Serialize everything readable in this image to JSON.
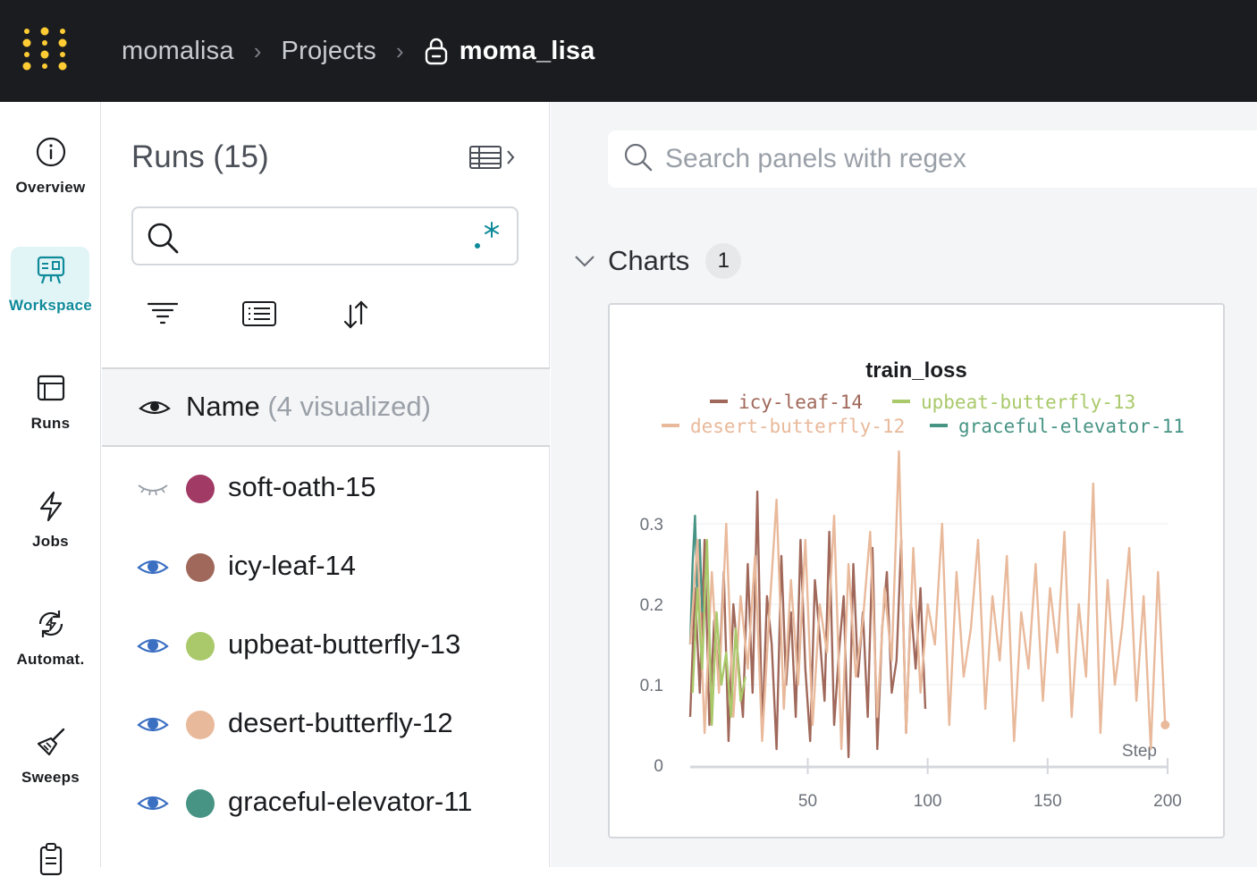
{
  "breadcrumb": {
    "entity": "momalisa",
    "section": "Projects",
    "project": "moma_lisa"
  },
  "nav": [
    {
      "label": "Overview",
      "icon": "info-icon"
    },
    {
      "label": "Workspace",
      "icon": "workspace-icon",
      "active": true
    },
    {
      "label": "Runs",
      "icon": "runs-table-icon"
    },
    {
      "label": "Jobs",
      "icon": "lightning-icon"
    },
    {
      "label": "Automat.",
      "icon": "automation-icon"
    },
    {
      "label": "Sweeps",
      "icon": "broom-icon"
    }
  ],
  "runs_panel": {
    "title": "Runs (15)",
    "search_value": "",
    "header_name": "Name",
    "header_sub": "(4 visualized)",
    "runs": [
      {
        "name": "soft-oath-15",
        "color": "#a23a66",
        "visible": false
      },
      {
        "name": "icy-leaf-14",
        "color": "#a0685a",
        "visible": true
      },
      {
        "name": "upbeat-butterfly-13",
        "color": "#a9c96a",
        "visible": true
      },
      {
        "name": "desert-butterfly-12",
        "color": "#e9b99b",
        "visible": true
      },
      {
        "name": "graceful-elevator-11",
        "color": "#479485",
        "visible": true
      }
    ]
  },
  "main": {
    "search_placeholder": "Search panels with regex",
    "section_title": "Charts",
    "section_count": "1"
  },
  "chart_data": {
    "type": "line",
    "title": "train_loss",
    "xlabel": "Step",
    "ylabel": "",
    "xlim": [
      1,
      200
    ],
    "ylim": [
      0,
      0.35
    ],
    "xticks": [
      50,
      100,
      150,
      200
    ],
    "yticks": [
      0,
      0.1,
      0.2,
      0.3
    ],
    "ytick_labels": [
      "0",
      "0.1",
      "0.2",
      "0.3"
    ],
    "grid": true,
    "legend": "top",
    "series": [
      {
        "name": "icy-leaf-14",
        "color": "#a0685a",
        "x": [
          1,
          3,
          5,
          7,
          9,
          11,
          13,
          15,
          17,
          19,
          21,
          23,
          25,
          27,
          29,
          31,
          33,
          35,
          37,
          39,
          41,
          43,
          45,
          47,
          49,
          51,
          53,
          55,
          57,
          59,
          61,
          63,
          65,
          67,
          69,
          71,
          73,
          75,
          77,
          79,
          81,
          83,
          85,
          87,
          89,
          91,
          93,
          95,
          97,
          99
        ],
        "y": [
          0.06,
          0.22,
          0.09,
          0.28,
          0.05,
          0.18,
          0.11,
          0.24,
          0.03,
          0.2,
          0.13,
          0.06,
          0.25,
          0.09,
          0.34,
          0.04,
          0.21,
          0.15,
          0.02,
          0.26,
          0.1,
          0.19,
          0.06,
          0.28,
          0.12,
          0.03,
          0.23,
          0.16,
          0.08,
          0.29,
          0.05,
          0.14,
          0.21,
          0.01,
          0.25,
          0.11,
          0.19,
          0.06,
          0.27,
          0.02,
          0.17,
          0.24,
          0.09,
          0.13,
          0.28,
          0.04,
          0.2,
          0.12,
          0.22,
          0.07
        ]
      },
      {
        "name": "upbeat-butterfly-13",
        "color": "#a9c96a",
        "x": [
          2,
          4,
          6,
          8,
          10,
          12,
          14,
          16,
          18,
          20,
          22,
          24
        ],
        "y": [
          0.09,
          0.22,
          0.12,
          0.28,
          0.05,
          0.19,
          0.1,
          0.14,
          0.06,
          0.17,
          0.08,
          0.11
        ]
      },
      {
        "name": "desert-butterfly-12",
        "color": "#e9b99b",
        "x": [
          1,
          4,
          7,
          10,
          13,
          16,
          19,
          22,
          25,
          28,
          31,
          34,
          37,
          40,
          43,
          46,
          49,
          52,
          55,
          58,
          61,
          64,
          67,
          70,
          73,
          76,
          79,
          82,
          85,
          88,
          91,
          94,
          97,
          100,
          103,
          106,
          109,
          112,
          115,
          118,
          121,
          124,
          127,
          130,
          133,
          136,
          139,
          142,
          145,
          148,
          151,
          154,
          157,
          160,
          163,
          166,
          169,
          172,
          175,
          178,
          181,
          184,
          187,
          190,
          193,
          196,
          199
        ],
        "y": [
          0.15,
          0.28,
          0.04,
          0.24,
          0.09,
          0.3,
          0.06,
          0.21,
          0.12,
          0.26,
          0.03,
          0.19,
          0.33,
          0.07,
          0.23,
          0.1,
          0.28,
          0.05,
          0.2,
          0.14,
          0.31,
          0.02,
          0.25,
          0.11,
          0.18,
          0.29,
          0.06,
          0.22,
          0.13,
          0.39,
          0.04,
          0.27,
          0.09,
          0.2,
          0.15,
          0.3,
          0.05,
          0.24,
          0.11,
          0.17,
          0.28,
          0.07,
          0.21,
          0.13,
          0.26,
          0.03,
          0.19,
          0.12,
          0.25,
          0.08,
          0.22,
          0.14,
          0.29,
          0.06,
          0.2,
          0.11,
          0.35,
          0.04,
          0.23,
          0.1,
          0.17,
          0.27,
          0.08,
          0.21,
          0.02,
          0.24,
          0.05
        ]
      },
      {
        "name": "graceful-elevator-11",
        "color": "#479485",
        "x": [
          1,
          2,
          3,
          4,
          5,
          6
        ],
        "y": [
          0.15,
          0.25,
          0.31,
          0.2,
          0.28,
          0.19
        ]
      }
    ]
  }
}
